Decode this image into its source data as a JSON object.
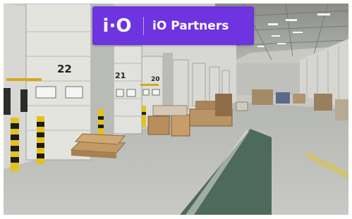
{
  "banner": {
    "logo_mark": "i·O",
    "partner_name": "iO Partners",
    "background_color": "#6d34e0"
  },
  "dock_doors": {
    "door_1": "22",
    "door_2": "21",
    "door_3": "20"
  }
}
